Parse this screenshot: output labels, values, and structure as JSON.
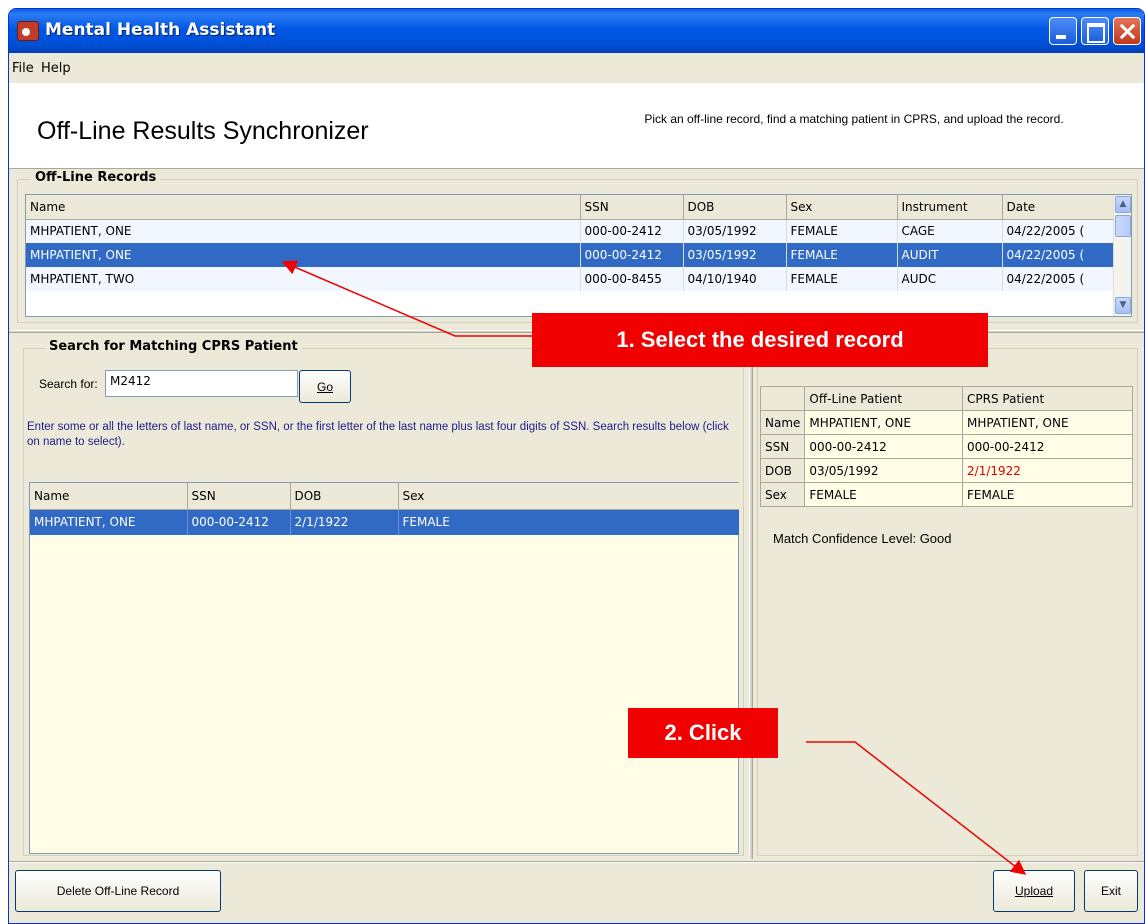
{
  "window": {
    "title": "Mental Health Assistant"
  },
  "menu": [
    "File",
    "Help"
  ],
  "header": {
    "title": "Off-Line Results Synchronizer",
    "instructions": "Pick an off-line record, find a matching patient in CPRS, and upload the record."
  },
  "offline": {
    "label": "Off-Line Records",
    "columns": [
      "Name",
      "SSN",
      "DOB",
      "Sex",
      "Instrument",
      "Date"
    ],
    "rows": [
      {
        "name": "MHPATIENT, ONE",
        "ssn": "000-00-2412",
        "dob": "03/05/1992",
        "sex": "FEMALE",
        "instrument": "CAGE",
        "date": "04/22/2005 ("
      },
      {
        "name": "MHPATIENT, ONE",
        "ssn": "000-00-2412",
        "dob": "03/05/1992",
        "sex": "FEMALE",
        "instrument": "AUDIT",
        "date": "04/22/2005 ("
      },
      {
        "name": "MHPATIENT, TWO",
        "ssn": "000-00-8455",
        "dob": "04/10/1940",
        "sex": "FEMALE",
        "instrument": "AUDC",
        "date": "04/22/2005 ("
      }
    ]
  },
  "search": {
    "label": "Search for Matching CPRS Patient",
    "for_label": "Search for:",
    "value": "M2412",
    "go": "Go",
    "help": "Enter some or all the letters of last name, or SSN, or the first letter of the last name plus last four digits of SSN. Search results below (click on name to select).",
    "columns": [
      "Name",
      "SSN",
      "DOB",
      "Sex"
    ],
    "results": [
      {
        "name": "MHPATIENT, ONE",
        "ssn": "000-00-2412",
        "dob": "2/1/1922",
        "sex": "FEMALE"
      }
    ]
  },
  "compare": {
    "col_offline": "Off-Line Patient",
    "col_cprs": "CPRS Patient",
    "rows": [
      {
        "label": "Name",
        "offline": "MHPATIENT, ONE",
        "cprs": "MHPATIENT, ONE"
      },
      {
        "label": "SSN",
        "offline": "000-00-2412",
        "cprs": "000-00-2412"
      },
      {
        "label": "DOB",
        "offline": "03/05/1992",
        "cprs": "2/1/1922"
      },
      {
        "label": "Sex",
        "offline": "FEMALE",
        "cprs": "FEMALE"
      }
    ],
    "confidence": "Match Confidence Level:  Good"
  },
  "buttons": {
    "delete": "Delete Off-Line Record",
    "upload": "Upload",
    "exit": "Exit"
  },
  "callouts": {
    "step1": "1. Select  the desired  record",
    "step2": "2. Click"
  },
  "colors": {
    "selection": "#316ac5",
    "callout": "#f00000",
    "mismatch": "#e00000"
  }
}
